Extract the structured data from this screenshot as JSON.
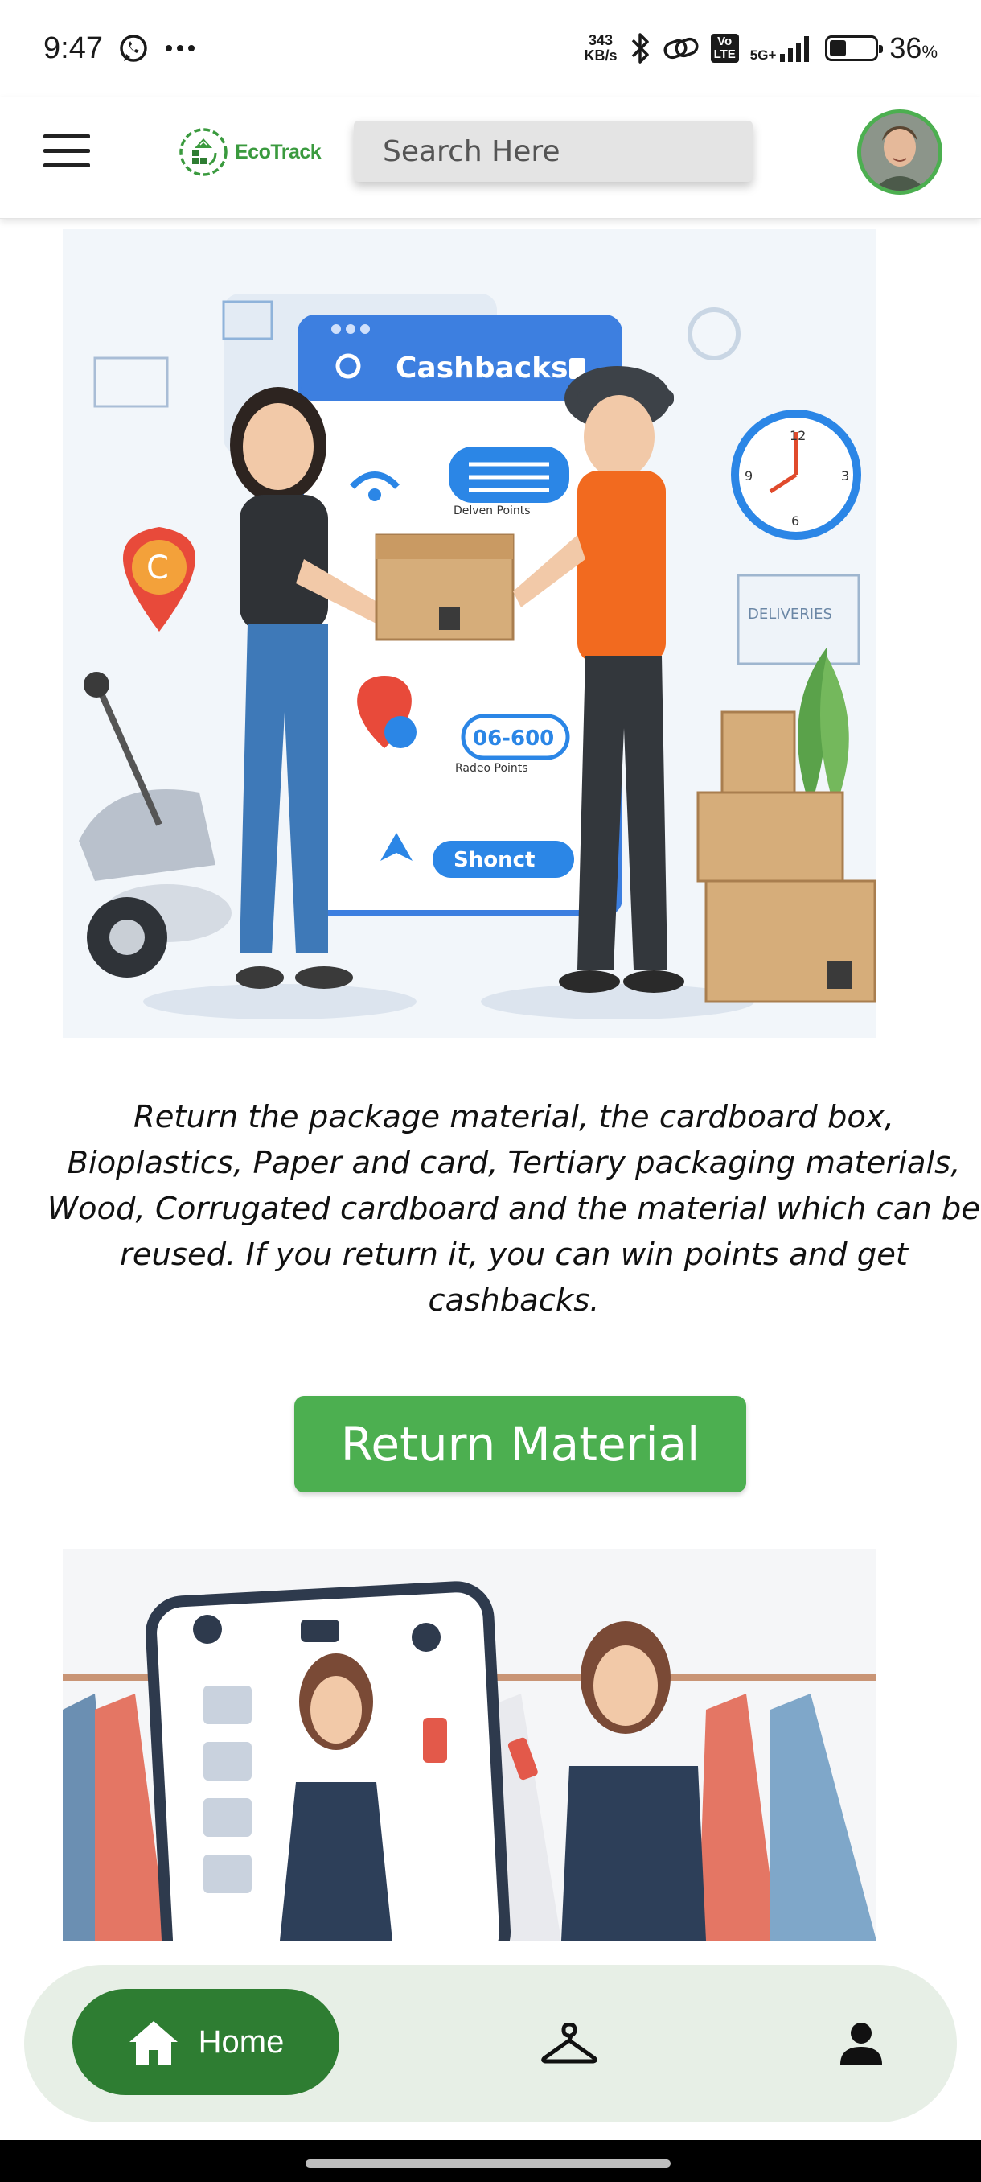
{
  "status_bar": {
    "time": "9:47",
    "net_speed_value": "343",
    "net_speed_unit": "KB/s",
    "lte_top": "Vo",
    "lte_bottom": "LTE",
    "network_type": "5G+",
    "battery_percent": "36",
    "battery_unit": "%",
    "battery_level": 0.36
  },
  "header": {
    "logo_text": "EcoTrack",
    "search_placeholder": "Search Here"
  },
  "hero": {
    "illustration_title": "Cashbacks",
    "label_points": "Delven Points",
    "label_code": "06-600",
    "label_reward": "Radeo Points",
    "label_button": "Shonct",
    "label_deliveries": "DELIVERIES"
  },
  "main": {
    "description": "Return the package material, the cardboard box, Bioplastics, Paper and card, Tertiary packaging materials, Wood, Corrugated cardboard and the material which can be reused. If you return it, you can win points and get cashbacks.",
    "return_button_label": "Return Material"
  },
  "bottom_nav": {
    "home_label": "Home",
    "active_color": "#2e7d32"
  },
  "colors": {
    "brand_green": "#4caf50",
    "nav_background": "#e7efe6"
  }
}
